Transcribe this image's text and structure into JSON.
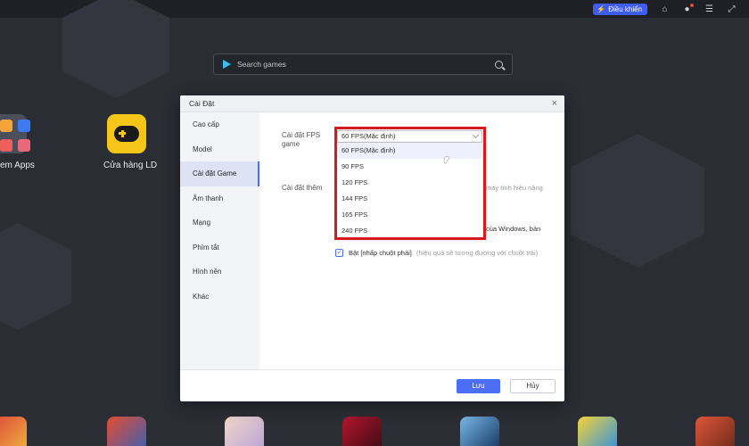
{
  "topbar": {
    "control_label": "Điều khiển",
    "icons": [
      "lightning-icon",
      "gamepad-icon",
      "user-icon",
      "settings-icon",
      "expand-icon"
    ]
  },
  "search": {
    "placeholder": "Search games"
  },
  "desktop": {
    "apps_label": "em Apps",
    "store_label": "Cửa hàng LD"
  },
  "dialog": {
    "title": "Cài Đặt",
    "close": "×",
    "sidebar": [
      {
        "label": "Cao cấp",
        "active": false
      },
      {
        "label": "Model",
        "active": false
      },
      {
        "label": "Cài đặt Game",
        "active": true
      },
      {
        "label": "Âm thanh",
        "active": false
      },
      {
        "label": "Mạng",
        "active": false
      },
      {
        "label": "Phím tắt",
        "active": false
      },
      {
        "label": "Hình nền",
        "active": false
      },
      {
        "label": "Khác",
        "active": false
      }
    ],
    "fps_label_1": "Cài đặt FPS",
    "fps_label_2": "game",
    "extra_label": "Cài đặt thêm",
    "perf_text": "máy tính hiệu năng",
    "windows_text": "của Windows, bản",
    "right_click_bold": "Bật [nhấp chuột phải]",
    "right_click_note": "(hiệu quả sẽ tương đương với chuột trái)",
    "checkbox_mark": "✓",
    "save": "Lưu",
    "cancel": "Hủy"
  },
  "fps_select": {
    "value": "60 FPS(Mặc định)",
    "options": [
      "60 FPS(Mặc định)",
      "90 FPS",
      "120 FPS",
      "144 FPS",
      "165 FPS",
      "240 FPS"
    ]
  },
  "colors": {
    "accent": "#4c6ef5",
    "highlight": "#d71920",
    "background": "#2b2d35"
  }
}
